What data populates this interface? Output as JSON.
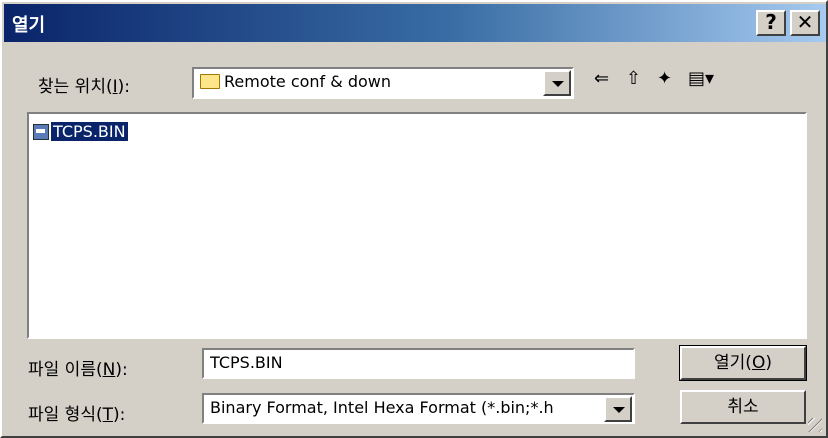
{
  "window": {
    "title": "열기",
    "help_label": "?",
    "close_label": "✕"
  },
  "look_in": {
    "label_pre": "찾는 위치(",
    "label_key": "I",
    "label_post": "):",
    "value": "Remote conf & down"
  },
  "toolbar": {
    "back_glyph": "⇐",
    "up_glyph": "⇧",
    "new_folder_glyph": "✦",
    "view_glyph": "▤▾"
  },
  "files": [
    {
      "name": "TCPS.BIN",
      "selected": true
    }
  ],
  "filename": {
    "label_pre": "파일 이름(",
    "label_key": "N",
    "label_post": "):",
    "value": "TCPS.BIN"
  },
  "filetype": {
    "label_pre": "파일 형식(",
    "label_key": "T",
    "label_post": "):",
    "value": "Binary Format, Intel Hexa Format (*.bin;*.h"
  },
  "buttons": {
    "open_pre": "열기(",
    "open_key": "O",
    "open_post": ")",
    "cancel": "취소"
  },
  "colors": {
    "title_start": "#0a246a",
    "title_end": "#a6caf0",
    "face": "#d4d0c8",
    "selection": "#0a246a"
  }
}
